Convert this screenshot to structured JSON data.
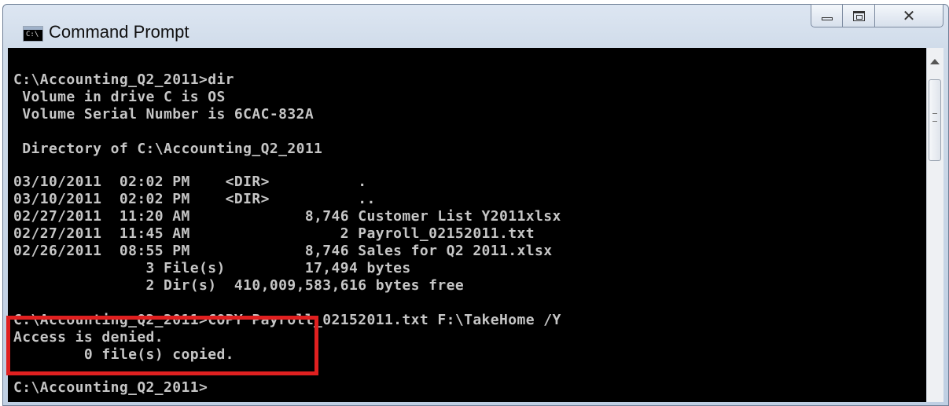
{
  "window": {
    "title": "Command Prompt",
    "icon": "cmd-icon",
    "icon_glyph": "C:\\",
    "controls": {
      "minimize": "minimize-icon",
      "maximize": "maximize-icon",
      "close": "close-icon",
      "close_glyph": "✕"
    }
  },
  "console": {
    "lines": [
      "C:\\Accounting_Q2_2011>dir",
      " Volume in drive C is OS",
      " Volume Serial Number is 6CAC-832A",
      "",
      " Directory of C:\\Accounting_Q2_2011",
      "",
      "03/10/2011  02:02 PM    <DIR>          .",
      "03/10/2011  02:02 PM    <DIR>          ..",
      "02/27/2011  11:20 AM             8,746 Customer List Y2011xlsx",
      "02/27/2011  11:45 AM                 2 Payroll_02152011.txt",
      "02/26/2011  08:55 PM             8,746 Sales for Q2 2011.xlsx",
      "               3 File(s)         17,494 bytes",
      "               2 Dir(s)  410,009,583,616 bytes free",
      "",
      "C:\\Accounting_Q2_2011>COPY Payroll_02152011.txt F:\\TakeHome /Y",
      "Access is denied.",
      "        0 file(s) copied.",
      "",
      "C:\\Accounting_Q2_2011>"
    ]
  },
  "colors": {
    "console_background": "#000000",
    "console_text": "#c6c6c6",
    "highlight": "#e02020"
  }
}
